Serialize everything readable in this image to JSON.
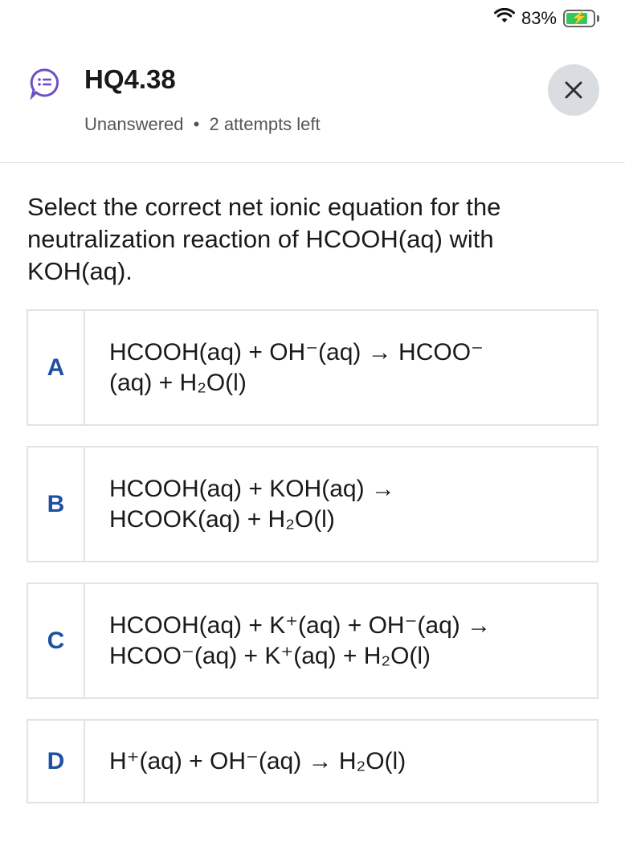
{
  "status": {
    "battery_percent": "83%",
    "battery_level": 0.83
  },
  "header": {
    "title": "HQ4.38",
    "status_text": "Unanswered",
    "separator": "•",
    "attempts_text": "2 attempts left"
  },
  "question": {
    "text": "Select the correct net ionic equation for the neutralization reaction of HCOOH(aq) with KOH(aq)."
  },
  "options": [
    {
      "letter": "A",
      "line1": "HCOOH(aq) + OH⁻(aq) → HCOO⁻",
      "line2": "(aq) + H₂O(l)"
    },
    {
      "letter": "B",
      "line1": "HCOOH(aq) + KOH(aq) →",
      "line2": "HCOOK(aq) + H₂O(l)"
    },
    {
      "letter": "C",
      "line1": "HCOOH(aq) + K⁺(aq) + OH⁻(aq) →",
      "line2": "HCOO⁻(aq) + K⁺(aq) + H₂O(l)"
    },
    {
      "letter": "D",
      "line1": "H⁺(aq) + OH⁻(aq) → H₂O(l)"
    }
  ],
  "colors": {
    "accent": "#1e50a2",
    "icon_purple": "#6b4fc8",
    "icon_yellow": "#f5c518"
  },
  "icons": [
    "wifi-icon",
    "battery-icon",
    "charging-bolt-icon",
    "question-chat-icon",
    "close-icon"
  ]
}
